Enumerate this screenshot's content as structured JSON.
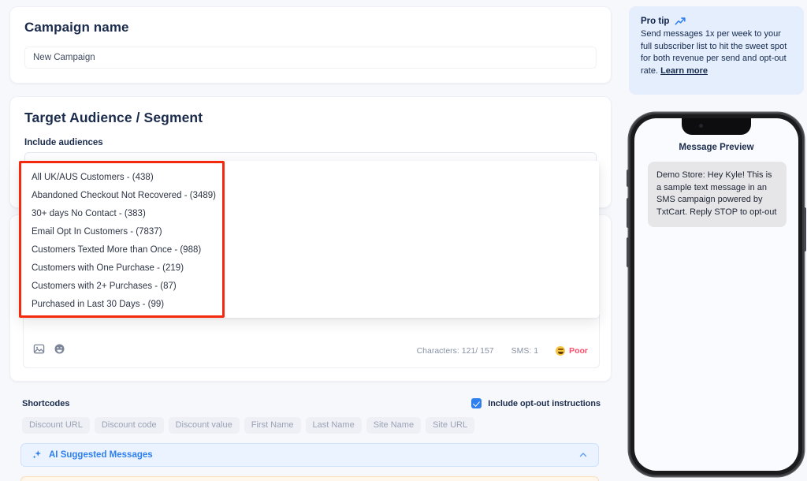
{
  "campaign": {
    "title": "Campaign name",
    "name_value": "New Campaign",
    "name_placeholder": "New Campaign"
  },
  "audience": {
    "title": "Target Audience / Segment",
    "include_label": "Include audiences",
    "select_value": "",
    "select_placeholder": "",
    "chevron_icon": "chevron-down-icon",
    "options": [
      "All UK/AUS Customers - (438)",
      "Abandoned Checkout Not Recovered - (3489)",
      "30+ days No Contact - (383)",
      "Email Opt In Customers - (7837)",
      "Customers Texted More than Once - (988)",
      "Customers with One Purchase - (219)",
      "Customers with 2+ Purchases - (87)",
      "Purchased in Last 30 Days - (99)"
    ],
    "highlight_color": "#f5290e"
  },
  "composer": {
    "image_icon": "image-icon",
    "emoji_icon": "emoji-icon",
    "characters_label": "Characters: 121/ 157",
    "sms_label": "SMS: 1",
    "quality_label": "Poor",
    "quality_icon": "grimace-emoji-icon",
    "quality_color": "#ff4d6a"
  },
  "shortcodes": {
    "title": "Shortcodes",
    "optout_label": "Include opt-out instructions",
    "optout_checked": true,
    "chips": [
      "Discount URL",
      "Discount code",
      "Discount value",
      "First Name",
      "Last Name",
      "Site Name",
      "Site URL"
    ]
  },
  "ai_panel": {
    "label": "AI Suggested Messages",
    "sparkle_icon": "sparkle-icon",
    "collapse_icon": "chevron-up-icon",
    "accent_color": "#2f7fef"
  },
  "pro_tip": {
    "heading": "Pro tip",
    "trend_icon": "trend-up-icon",
    "body": "Send messages 1x per week to your full subscriber list to hit the sweet spot for both revenue per send and opt-out rate.",
    "link_label": "Learn more"
  },
  "phone_preview": {
    "title": "Message Preview",
    "message": "Demo Store: Hey Kyle! This is a sample text message in an SMS campaign powered by TxtCart. Reply STOP to opt-out"
  }
}
